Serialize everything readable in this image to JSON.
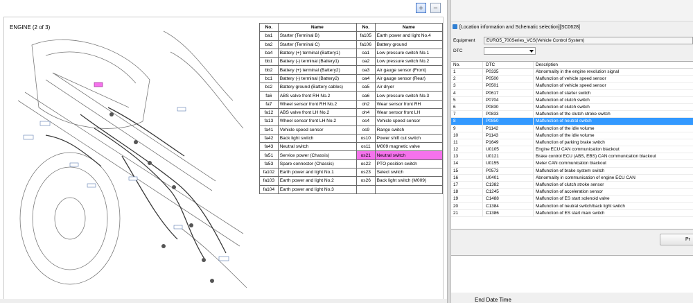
{
  "viewer": {
    "zoom_in_label": "+",
    "zoom_out_label": "−",
    "diagram_title": "ENGINE (2 of 3)",
    "table_headers": [
      "No.",
      "Name",
      "No.",
      "Name"
    ],
    "rows": [
      [
        "ba1",
        "Starter (Terminal B)",
        "fa105",
        "Earth power and light No.4"
      ],
      [
        "ba2",
        "Starter (Terminal C)",
        "fa106",
        "Battery ground"
      ],
      [
        "ba4",
        "Battery (+) terminal (Battery1)",
        "oa1",
        "Low pressure switch No.1"
      ],
      [
        "bb1",
        "Battery (-) terminal (Battery1)",
        "oa2",
        "Low pressure switch No.2"
      ],
      [
        "bb2",
        "Battery (+) terminal (Battery2)",
        "oa3",
        "Air gauge sensor (Front)"
      ],
      [
        "bc1",
        "Battery (-) terminal (Battery2)",
        "oa4",
        "Air gauge sensor (Rear)"
      ],
      [
        "bc2",
        "Battery ground (Battery cables)",
        "oa5",
        "Air dryer"
      ],
      [
        "fa6",
        "ABS valve front RH No.2",
        "oa6",
        "Low pressure switch No.3"
      ],
      [
        "fa7",
        "Wheel sensor front RH No.2",
        "oh2",
        "Wear sensor front RH"
      ],
      [
        "fa12",
        "ABS valve front LH No.2",
        "oh4",
        "Wear sensor front LH"
      ],
      [
        "fa13",
        "Wheel sensor front LH No.2",
        "os4",
        "Vehicle speed sensor"
      ],
      [
        "fa41",
        "Vehicle speed sensor",
        "os9",
        "Range switch"
      ],
      [
        "fa42",
        "Back light switch",
        "os10",
        "Power shift cut switch"
      ],
      [
        "fa43",
        "Neutral switch",
        "os11",
        "M009 magnetic valve"
      ],
      [
        "fa51",
        "Service power (Chassis)",
        "os21",
        "Neutral switch"
      ],
      [
        "fa53",
        "Spare connector (Chassis)",
        "os22",
        "PTO position switch"
      ],
      [
        "fa102",
        "Earth power and light No.1",
        "os23",
        "Select switch"
      ],
      [
        "fa103",
        "Earth power and light No.2",
        "os26",
        "Back light switch (M009)"
      ],
      [
        "fa104",
        "Earth power and light No.3",
        "",
        ""
      ]
    ],
    "highlight_row_index": 14
  },
  "dialog": {
    "title": "[Location information and Schematic selection][SC0628]",
    "equipment_label": "Equipment",
    "equipment_value": "EURO5_700Series_VCS(Vehicle Control System)",
    "dtc_label": "DTC",
    "dtc_value": "",
    "list_headers": [
      "No.",
      "DTC",
      "Description"
    ],
    "selected_index": 7,
    "dtc_rows": [
      [
        "1",
        "P0335",
        "Abnormality in the engine revolution signal"
      ],
      [
        "2",
        "P0500",
        "Malfunction of vehicle speed sensor"
      ],
      [
        "3",
        "P0501",
        "Malfunction of vehicle speed sensor"
      ],
      [
        "4",
        "P0617",
        "Malfunction of starter switch"
      ],
      [
        "5",
        "P0704",
        "Malfunction of clutch switch"
      ],
      [
        "6",
        "P0830",
        "Malfunction of clutch switch"
      ],
      [
        "7",
        "P0833",
        "Malfunction of the clutch stroke switch"
      ],
      [
        "8",
        "P0850",
        "Malfunction of neutral switch"
      ],
      [
        "9",
        "P1142",
        "Malfunction of the idle volume"
      ],
      [
        "10",
        "P1143",
        "Malfunction of the idle volume"
      ],
      [
        "11",
        "P1649",
        "Malfunction of parking brake switch"
      ],
      [
        "12",
        "U0105",
        "Engine ECU CAN communication blackout"
      ],
      [
        "13",
        "U0121",
        "Brake control ECU (ABS, EBS) CAN communication blackout"
      ],
      [
        "14",
        "U0155",
        "Meter CAN communication blackout"
      ],
      [
        "15",
        "P0573",
        "Malfunction of brake system switch"
      ],
      [
        "16",
        "U0401",
        "Abnormality in communication of engine ECU CAN"
      ],
      [
        "17",
        "C1382",
        "Malfunction of clutch stroke sensor"
      ],
      [
        "18",
        "C1245",
        "Malfunction of acceleration sensor"
      ],
      [
        "19",
        "C1488",
        "Malfunction of ES start solenoid valve"
      ],
      [
        "20",
        "C1384",
        "Malfunction of neutral switch/back light switch"
      ],
      [
        "21",
        "C1386",
        "Malfunction of ES start main switch"
      ]
    ],
    "print_label": "Pr",
    "end_date_label": "End Date Time"
  },
  "colors": {
    "highlight": "#f572ec",
    "selection": "#3399ff"
  }
}
